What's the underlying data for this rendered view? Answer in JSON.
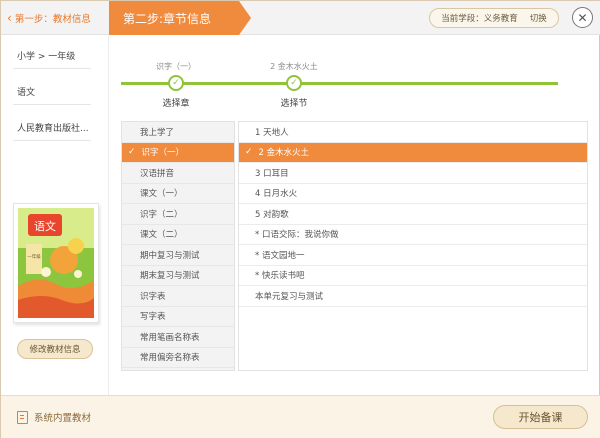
{
  "header": {
    "step1_label": "第一步：教材信息",
    "step2_label": "第二步:章节信息",
    "stage_label": "当前学段：义务教育",
    "switch_label": "切换",
    "close_symbol": "✕"
  },
  "sidebar": {
    "items": [
      {
        "label": "小学 > 一年级"
      },
      {
        "label": "语文"
      },
      {
        "label": "人民教育出版社..."
      }
    ],
    "book_title": "语文",
    "book_grade": "一年级",
    "edit_button": "修改教材信息"
  },
  "progress": {
    "chapter_value": "识字（一）",
    "chapter_label": "选择章",
    "section_value": "2 金木水火土",
    "section_label": "选择节",
    "accent": "#8fc33a"
  },
  "chapters": [
    {
      "label": "我上学了",
      "selected": false
    },
    {
      "label": "识字（一）",
      "selected": true
    },
    {
      "label": "汉语拼音",
      "selected": false
    },
    {
      "label": "课文（一）",
      "selected": false
    },
    {
      "label": "识字（二）",
      "selected": false
    },
    {
      "label": "课文（二）",
      "selected": false
    },
    {
      "label": "期中复习与测试",
      "selected": false
    },
    {
      "label": "期末复习与测试",
      "selected": false
    },
    {
      "label": "识字表",
      "selected": false
    },
    {
      "label": "写字表",
      "selected": false
    },
    {
      "label": "常用笔画名称表",
      "selected": false
    },
    {
      "label": "常用偏旁名称表",
      "selected": false
    }
  ],
  "sections": [
    {
      "label": "1 天地人",
      "selected": false
    },
    {
      "label": "2 金木水火土",
      "selected": true
    },
    {
      "label": "3 口耳目",
      "selected": false
    },
    {
      "label": "4 日月水火",
      "selected": false
    },
    {
      "label": "5 对韵歌",
      "selected": false
    },
    {
      "label": "* 口语交际：我说你做",
      "selected": false
    },
    {
      "label": "* 语文园地一",
      "selected": false
    },
    {
      "label": "* 快乐读书吧",
      "selected": false
    },
    {
      "label": "本单元复习与测试",
      "selected": false
    }
  ],
  "footer": {
    "builtin_label": "系统内置教材",
    "start_button": "开始备课"
  },
  "colors": {
    "orange": "#f08a3c",
    "green": "#8fc33a"
  }
}
